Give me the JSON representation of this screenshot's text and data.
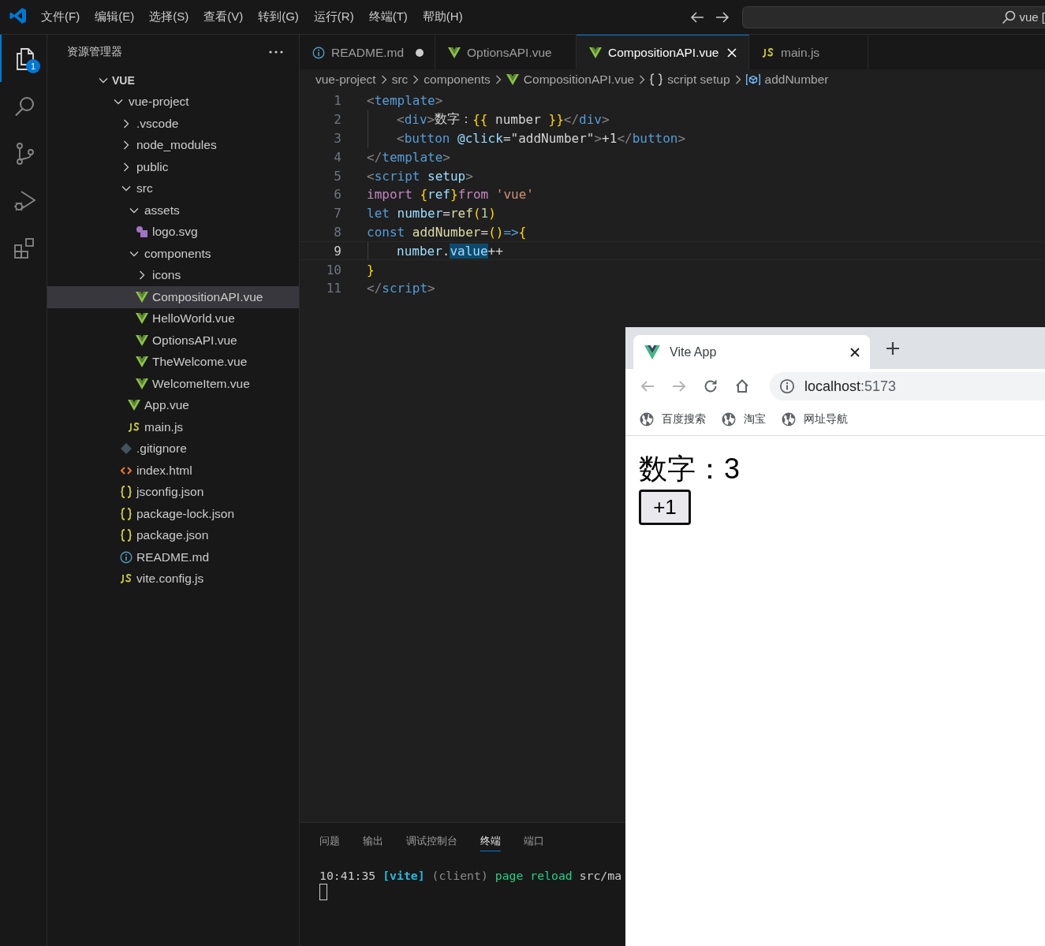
{
  "title_bar": {
    "menu": [
      {
        "label": "文件(F)"
      },
      {
        "label": "编辑(E)"
      },
      {
        "label": "选择(S)"
      },
      {
        "label": "查看(V)"
      },
      {
        "label": "转到(G)"
      },
      {
        "label": "运行(R)"
      },
      {
        "label": "终端(T)"
      },
      {
        "label": "帮助(H)"
      }
    ],
    "search": {
      "value": "vue ["
    }
  },
  "activity_bar": [
    {
      "kind": "explorer",
      "selected": true,
      "badge": "1"
    },
    {
      "kind": "search",
      "selected": false
    },
    {
      "kind": "source-control",
      "selected": false
    },
    {
      "kind": "run-debug",
      "selected": false
    },
    {
      "kind": "extensions",
      "selected": false
    }
  ],
  "sidebar": {
    "title": "资源管理器",
    "section": {
      "label": "VUE",
      "expanded": true
    },
    "tree": [
      {
        "label": "vue-project",
        "kind": "folder",
        "expanded": true,
        "selected": false,
        "children": [
          {
            "label": ".vscode",
            "kind": "folder",
            "expanded": false,
            "selected": false
          },
          {
            "label": "node_modules",
            "kind": "folder",
            "expanded": false,
            "selected": false
          },
          {
            "label": "public",
            "kind": "folder",
            "expanded": false,
            "selected": false
          },
          {
            "label": "src",
            "kind": "folder",
            "expanded": true,
            "selected": false,
            "children": [
              {
                "label": "assets",
                "kind": "folder",
                "expanded": true,
                "selected": false,
                "children": [
                  {
                    "label": "logo.svg",
                    "kind": "svg",
                    "selected": false
                  }
                ]
              },
              {
                "label": "components",
                "kind": "folder",
                "expanded": true,
                "selected": false,
                "children": [
                  {
                    "label": "icons",
                    "kind": "folder",
                    "expanded": false,
                    "selected": false
                  },
                  {
                    "label": "CompositionAPI.vue",
                    "kind": "vue",
                    "selected": true
                  },
                  {
                    "label": "HelloWorld.vue",
                    "kind": "vue",
                    "selected": false
                  },
                  {
                    "label": "OptionsAPI.vue",
                    "kind": "vue",
                    "selected": false
                  },
                  {
                    "label": "TheWelcome.vue",
                    "kind": "vue",
                    "selected": false
                  },
                  {
                    "label": "WelcomeItem.vue",
                    "kind": "vue",
                    "selected": false
                  }
                ]
              },
              {
                "label": "App.vue",
                "kind": "vue",
                "selected": false
              },
              {
                "label": "main.js",
                "kind": "js",
                "selected": false
              }
            ]
          },
          {
            "label": ".gitignore",
            "kind": "git",
            "selected": false
          },
          {
            "label": "index.html",
            "kind": "html",
            "selected": false
          },
          {
            "label": "jsconfig.json",
            "kind": "json",
            "selected": false
          },
          {
            "label": "package-lock.json",
            "kind": "json",
            "selected": false
          },
          {
            "label": "package.json",
            "kind": "json",
            "selected": false
          },
          {
            "label": "README.md",
            "kind": "info",
            "selected": false
          },
          {
            "label": "vite.config.js",
            "kind": "js",
            "selected": false
          }
        ]
      }
    ]
  },
  "editor": {
    "tabs": [
      {
        "label": "README.md",
        "kind": "info",
        "selected": false,
        "modified": true
      },
      {
        "label": "OptionsAPI.vue",
        "kind": "vue",
        "selected": false,
        "modified": false
      },
      {
        "label": "CompositionAPI.vue",
        "kind": "vue",
        "selected": true,
        "modified": false
      },
      {
        "label": "main.js",
        "kind": "js",
        "selected": false,
        "modified": false
      }
    ],
    "breadcrumbs": [
      {
        "label": "vue-project",
        "kind": "folder"
      },
      {
        "label": "src",
        "kind": "folder"
      },
      {
        "label": "components",
        "kind": "folder"
      },
      {
        "label": "CompositionAPI.vue",
        "kind": "vue"
      },
      {
        "label": "script setup",
        "kind": "braces"
      },
      {
        "label": "addNumber",
        "kind": "symbol"
      }
    ],
    "lines": [
      {
        "number": "1",
        "indented": false,
        "current": false,
        "tokens": [
          {
            "kind": "punct",
            "text": "<"
          },
          {
            "kind": "tag",
            "text": "template"
          },
          {
            "kind": "punct",
            "text": ">"
          }
        ]
      },
      {
        "number": "2",
        "indented": true,
        "current": false,
        "tokens": [
          {
            "kind": "punct",
            "text": "<"
          },
          {
            "kind": "tag",
            "text": "div"
          },
          {
            "kind": "punct",
            "text": ">"
          },
          {
            "kind": "plain",
            "text": "数字："
          },
          {
            "kind": "bracket",
            "text": "{{"
          },
          {
            "kind": "plain",
            "text": " number "
          },
          {
            "kind": "bracket",
            "text": "}}"
          },
          {
            "kind": "punct",
            "text": "</"
          },
          {
            "kind": "tag",
            "text": "div"
          },
          {
            "kind": "punct",
            "text": ">"
          }
        ]
      },
      {
        "number": "3",
        "indented": true,
        "current": false,
        "tokens": [
          {
            "kind": "punct",
            "text": "<"
          },
          {
            "kind": "tag",
            "text": "button "
          },
          {
            "kind": "attr",
            "text": "@click"
          },
          {
            "kind": "plain",
            "text": "=\"addNumber\""
          },
          {
            "kind": "punct",
            "text": ">"
          },
          {
            "kind": "plain",
            "text": "+1"
          },
          {
            "kind": "punct",
            "text": "</"
          },
          {
            "kind": "tag",
            "text": "button"
          },
          {
            "kind": "punct",
            "text": ">"
          }
        ]
      },
      {
        "number": "4",
        "indented": false,
        "current": false,
        "tokens": [
          {
            "kind": "punct",
            "text": "</"
          },
          {
            "kind": "tag",
            "text": "template"
          },
          {
            "kind": "punct",
            "text": ">"
          }
        ]
      },
      {
        "number": "5",
        "indented": false,
        "current": false,
        "tokens": [
          {
            "kind": "punct",
            "text": "<"
          },
          {
            "kind": "tag",
            "text": "script "
          },
          {
            "kind": "attr",
            "text": "setup"
          },
          {
            "kind": "punct",
            "text": ">"
          }
        ]
      },
      {
        "number": "6",
        "indented": false,
        "current": false,
        "tokens": [
          {
            "kind": "keyword",
            "text": "import "
          },
          {
            "kind": "bracket",
            "text": "{"
          },
          {
            "kind": "variable",
            "text": "ref"
          },
          {
            "kind": "bracket",
            "text": "}"
          },
          {
            "kind": "keyword",
            "text": "from "
          },
          {
            "kind": "string",
            "text": "'vue'"
          }
        ]
      },
      {
        "number": "7",
        "indented": false,
        "current": false,
        "tokens": [
          {
            "kind": "storage",
            "text": "let "
          },
          {
            "kind": "variable",
            "text": "number"
          },
          {
            "kind": "plain",
            "text": "="
          },
          {
            "kind": "function",
            "text": "ref"
          },
          {
            "kind": "bracket",
            "text": "("
          },
          {
            "kind": "number",
            "text": "1"
          },
          {
            "kind": "bracket",
            "text": ")"
          }
        ]
      },
      {
        "number": "8",
        "indented": false,
        "current": false,
        "tokens": [
          {
            "kind": "storage",
            "text": "const "
          },
          {
            "kind": "function",
            "text": "addNumber"
          },
          {
            "kind": "plain",
            "text": "="
          },
          {
            "kind": "bracket",
            "text": "()"
          },
          {
            "kind": "storage",
            "text": "=>"
          },
          {
            "kind": "bracket",
            "text": "{"
          }
        ]
      },
      {
        "number": "9",
        "indented": true,
        "current": true,
        "tokens": [
          {
            "kind": "variable",
            "text": "number"
          },
          {
            "kind": "plain",
            "text": "."
          },
          {
            "kind": "match",
            "text": "value"
          },
          {
            "kind": "plain",
            "text": "++"
          }
        ]
      },
      {
        "number": "10",
        "indented": false,
        "current": false,
        "tokens": [
          {
            "kind": "bracket",
            "text": "}"
          }
        ]
      },
      {
        "number": "11",
        "indented": false,
        "current": false,
        "tokens": [
          {
            "kind": "punct",
            "text": "</"
          },
          {
            "kind": "tag",
            "text": "script"
          },
          {
            "kind": "punct",
            "text": ">"
          }
        ]
      }
    ]
  },
  "panel": {
    "tabs": [
      {
        "label": "问题",
        "selected": false
      },
      {
        "label": "输出",
        "selected": false
      },
      {
        "label": "调试控制台",
        "selected": false
      },
      {
        "label": "终端",
        "selected": true
      },
      {
        "label": "端口",
        "selected": false
      }
    ],
    "terminal": {
      "tokens": [
        {
          "kind": "plain",
          "text": "10:41:35 "
        },
        {
          "kind": "vite",
          "text": "[vite]"
        },
        {
          "kind": "dim",
          "text": " (client)"
        },
        {
          "kind": "green",
          "text": " page reload"
        },
        {
          "kind": "plain",
          "text": " src/ma"
        }
      ]
    }
  },
  "browser": {
    "tab": {
      "title": "Vite App",
      "selected": true
    },
    "back": {
      "disabled": true
    },
    "forward": {
      "disabled": true
    },
    "url": {
      "host": "localhost",
      "port": ":5173"
    },
    "bookmarks": [
      {
        "label": "百度搜索"
      },
      {
        "label": "淘宝"
      },
      {
        "label": "网址导航"
      }
    ],
    "page": {
      "heading": "数字：3",
      "button": {
        "label": "+1",
        "focused": true
      }
    }
  }
}
